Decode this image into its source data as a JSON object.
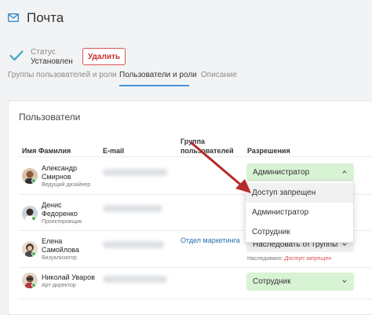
{
  "header": {
    "title": "Почта",
    "icon": "mail-icon"
  },
  "status": {
    "label": "Статус",
    "value": "Установлен",
    "icon": "checkmark-icon",
    "color": "#3aa6c9"
  },
  "actions": {
    "delete_label": "Удалить",
    "delete_color": "#c9302c"
  },
  "tabs": [
    {
      "label": "Группы пользователей и роли",
      "active": false
    },
    {
      "label": "Пользователи и роли",
      "active": true
    },
    {
      "label": "Описание",
      "active": false
    }
  ],
  "panel": {
    "title": "Пользователи",
    "columns": {
      "name": "Имя Фамилия",
      "email": "E-mail",
      "group": "Группа пользователей",
      "permissions": "Разрешения"
    }
  },
  "users": [
    {
      "first": "Александр",
      "last": "Смирнов",
      "role": "Ведущий дизайнер",
      "group": "",
      "permission": "Администратор",
      "permission_style": "green",
      "chevron": "up"
    },
    {
      "first": "Денис",
      "last": "Федоренко",
      "role": "Проектировщик",
      "group": "",
      "permission": "",
      "permission_style": "none"
    },
    {
      "first": "Елена",
      "last": "Самойлова",
      "role": "Визуализатор",
      "group": "Отдел маркетинга",
      "permission": "Наследовать от группы",
      "permission_style": "gray",
      "chevron": "down",
      "inherited_label": "Наследовано:",
      "inherited_value": "Доступ запрещен"
    },
    {
      "first": "Николай",
      "last": "Уваров",
      "role": "Арт-директор",
      "group": "",
      "permission": "Сотрудник",
      "permission_style": "green",
      "chevron": "down"
    }
  ],
  "dropdown": {
    "options": [
      "Доступ запрещен",
      "Администратор",
      "Сотрудник"
    ],
    "highlighted": "Доступ запрещен"
  },
  "colors": {
    "accent": "#4a90d9",
    "green_bg": "#d8f3d4",
    "link": "#2b6cb0",
    "danger": "#d9534f",
    "annotation_arrow": "#b52a2a"
  }
}
